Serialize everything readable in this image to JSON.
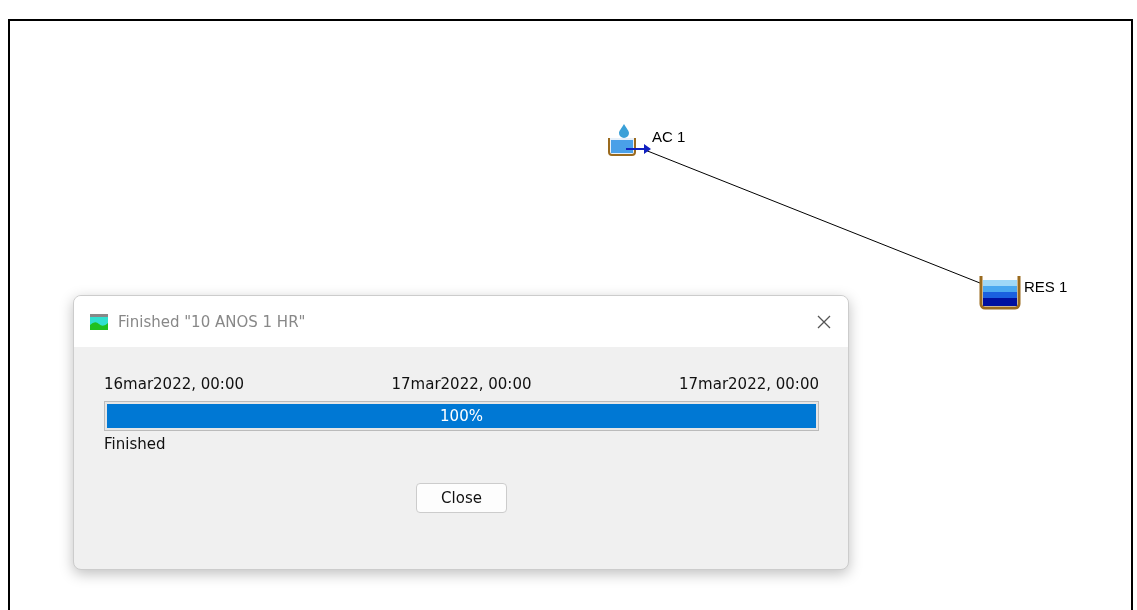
{
  "diagram": {
    "nodes": [
      {
        "kind": "subbasin",
        "label": "AC 1"
      },
      {
        "kind": "reservoir",
        "label": "RES 1"
      }
    ]
  },
  "dialog": {
    "title": "Finished \"10 ANOS 1 HR\"",
    "times": [
      "16mar2022, 00:00",
      "17mar2022, 00:00",
      "17mar2022, 00:00"
    ],
    "progress": {
      "level": 1,
      "reading": "100%"
    },
    "status": "Finished",
    "buttons": [
      "Close"
    ]
  }
}
